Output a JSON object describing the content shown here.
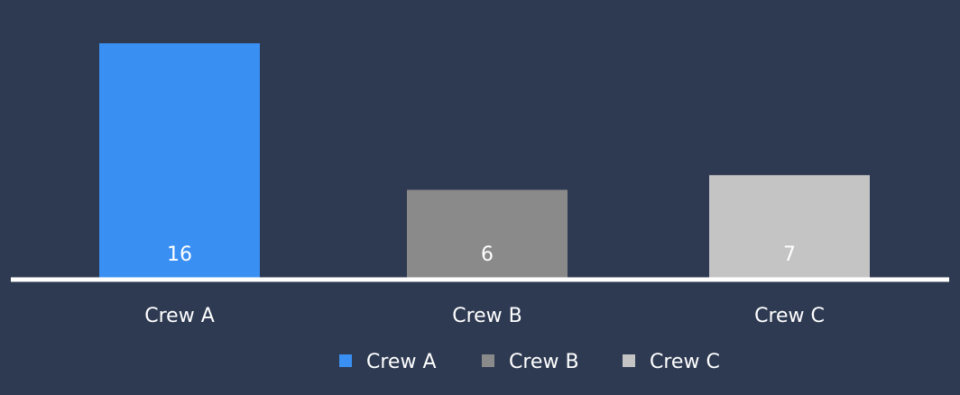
{
  "chart_data": {
    "type": "bar",
    "title": "",
    "xlabel": "",
    "ylabel": "",
    "categories": [
      "Crew A",
      "Crew B",
      "Crew C"
    ],
    "values": [
      16,
      6,
      7
    ],
    "colors": [
      "#3a8ff2",
      "#8a8a8a",
      "#c4c4c4"
    ],
    "ylim": [
      0,
      16
    ],
    "grid": false,
    "legend": {
      "position": "bottom",
      "entries": [
        "Crew A",
        "Crew B",
        "Crew C"
      ]
    },
    "axis_color": "#ffffff",
    "background": "#2e3a52"
  }
}
